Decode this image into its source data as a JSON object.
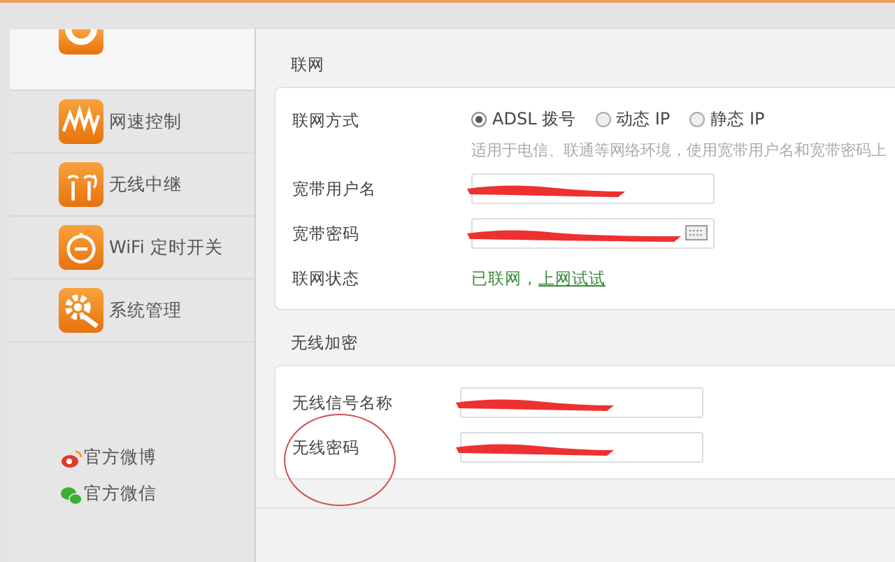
{
  "sidebar": {
    "items": [
      {
        "selected": true
      },
      {
        "label": "网速控制",
        "selected": false
      },
      {
        "label": "无线中继",
        "selected": false
      },
      {
        "label": "WiFi 定时开关",
        "selected": false
      },
      {
        "label": "系统管理",
        "selected": false
      }
    ],
    "links": [
      {
        "label": "官方微博"
      },
      {
        "label": "官方微信"
      }
    ]
  },
  "sections": [
    {
      "title": "联网",
      "rows": [
        {
          "kind": "radio",
          "label": "联网方式",
          "options": [
            {
              "label": "ADSL 拨号",
              "selected": true
            },
            {
              "label": "动态 IP",
              "selected": false
            },
            {
              "label": "静态 IP",
              "selected": false
            }
          ],
          "hint": "适用于电信、联通等网络环境，使用宽带用户名和宽带密码上"
        },
        {
          "kind": "field",
          "label": "宽带用户名",
          "redacted": true,
          "keyboard": false
        },
        {
          "kind": "field",
          "label": "宽带密码",
          "redacted": true,
          "keyboard": true
        },
        {
          "kind": "status",
          "label": "联网状态",
          "status": "已联网，",
          "link": "上网试试"
        }
      ]
    },
    {
      "title": "无线加密",
      "rows": [
        {
          "kind": "field",
          "label": "无线信号名称",
          "redacted": true,
          "keyboard": false
        },
        {
          "kind": "field",
          "label": "无线密码",
          "redacted": true,
          "keyboard": false,
          "circled": true
        }
      ]
    }
  ]
}
